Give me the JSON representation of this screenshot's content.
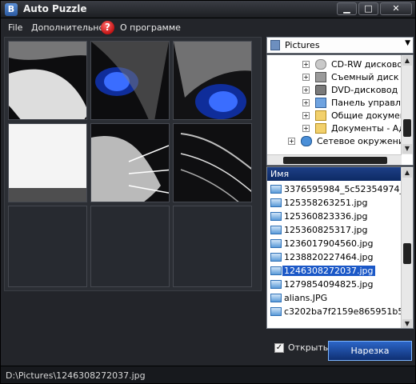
{
  "window": {
    "title": "Auto Puzzle"
  },
  "menu": {
    "file": "File",
    "extra": "Дополнительно",
    "about": "О программе"
  },
  "drive": {
    "selected": "Pictures"
  },
  "tree": {
    "items": [
      "CD-RW дисково...",
      "Съемный диск (I...",
      "DVD-дисковод (K...",
      "Панель управле...",
      "Общие документ...",
      "Документы - Ад...",
      "Сетевое окружение"
    ]
  },
  "files": {
    "header": "Имя",
    "items": [
      "3376595984_5c52354974_o.jpg",
      "125358263251.jpg",
      "125360823336.jpg",
      "125360825317.jpg",
      "1236017904560.jpg",
      "1238820227464.jpg",
      "1246308272037.jpg",
      "1279854094825.jpg",
      "alians.JPG",
      "c3202ba7f2159e865951b589..."
    ],
    "selected_index": 6
  },
  "controls": {
    "open_label": "Открыть",
    "open_checked": true,
    "cut_button": "Нарезка"
  },
  "status": {
    "path": "D:\\Pictures\\1246308272037.jpg"
  }
}
